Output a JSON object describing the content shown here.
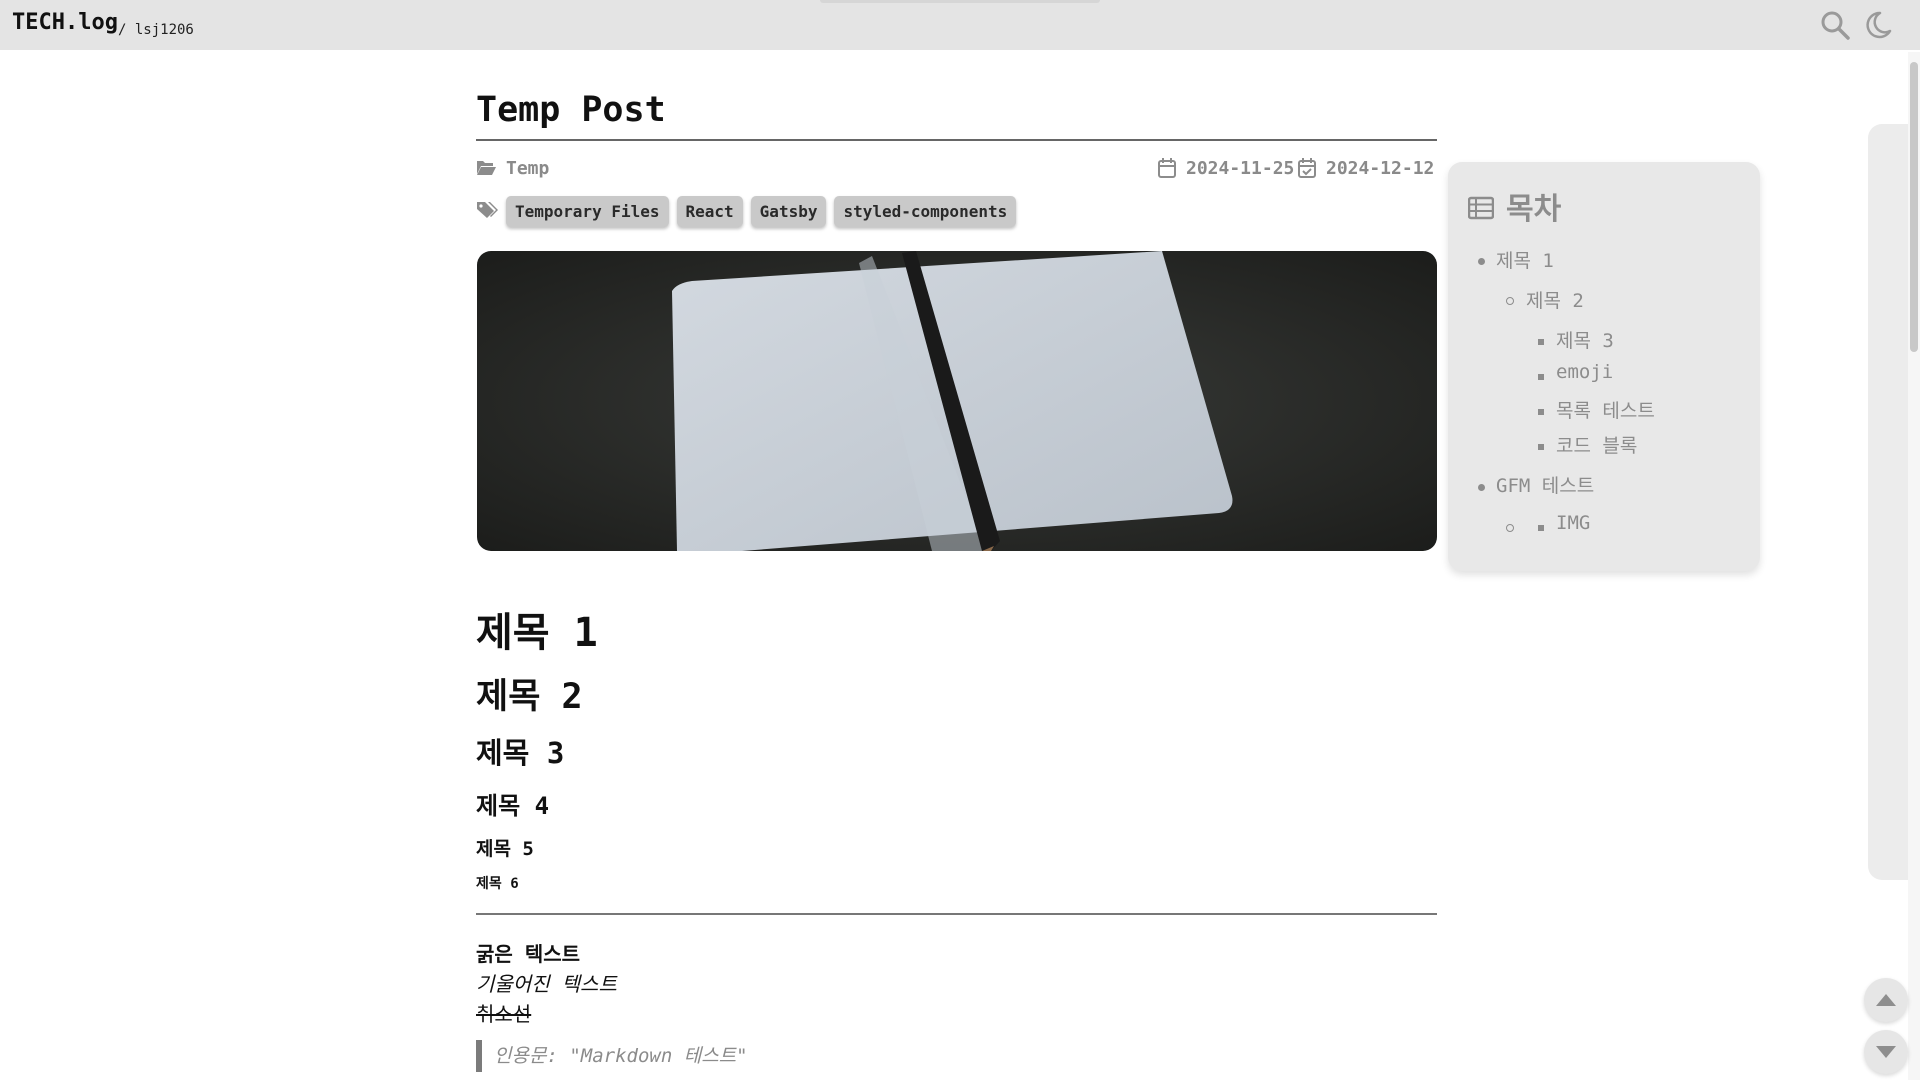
{
  "header": {
    "logo": "TECH.log",
    "username": "/ lsj1206"
  },
  "post": {
    "title": "Temp Post",
    "category": "Temp",
    "created_date": "2024-11-25",
    "updated_date": "2024-12-12",
    "tags": [
      "Temporary Files",
      "React",
      "Gatsby",
      "styled-components"
    ],
    "thumbnail": "notebook with pencil on dark background"
  },
  "content": {
    "h1": "제목 1",
    "h2": "제목 2",
    "h3": "제목 3",
    "h4": "제목 4",
    "h5": "제목 5",
    "h6": "제목 6",
    "bold": "굵은 텍스트",
    "italic": "기울어진 텍스트",
    "strike": "취소선",
    "blockquote": "인용문: \"Markdown 테스트\""
  },
  "toc": {
    "title": "목차",
    "items": [
      {
        "label": "제목 1",
        "level": 1
      },
      {
        "label": "제목 2",
        "level": 2
      },
      {
        "label": "제목 3",
        "level": 3
      },
      {
        "label": "emoji",
        "level": 3
      },
      {
        "label": "목록 테스트",
        "level": 3
      },
      {
        "label": "코드 블록",
        "level": 3
      },
      {
        "label": "GFM 테스트",
        "level": 1
      },
      {
        "label": "IMG",
        "level": 3
      }
    ]
  },
  "icons": {
    "search": "search-icon",
    "theme": "moon-icon",
    "category": "folder-open-icon",
    "created": "calendar-icon",
    "updated": "calendar-check-icon",
    "tags": "tags-icon",
    "toc": "list-icon",
    "scroll_up": "caret-up-icon",
    "scroll_down": "caret-down-icon"
  },
  "colors": {
    "header_bg": "#e4e4e4",
    "muted_text": "#8c8c8c",
    "tag_bg": "#c9c9c9",
    "toc_bg": "#e8e8e8"
  }
}
